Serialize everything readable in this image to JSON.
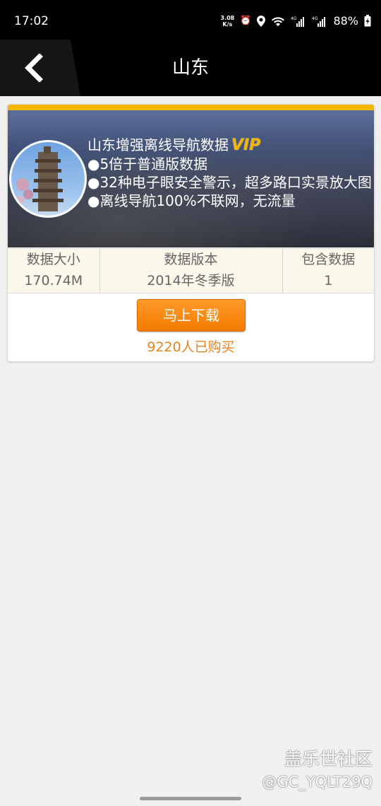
{
  "status_bar": {
    "time": "17:02",
    "net_speed_value": "3.08",
    "net_speed_unit": "K/s",
    "battery": "88%",
    "icons": [
      "alarm-icon",
      "location-icon",
      "wifi-icon",
      "signal-4g-icon",
      "signal-4g-icon",
      "battery-charging-icon"
    ]
  },
  "header": {
    "title": "山东",
    "back_icon": "chevron-left-icon"
  },
  "card": {
    "accent_color": "#f2b700",
    "product_title": "山东增强离线导航数据",
    "badge": "VIP",
    "features": [
      "●5倍于普通版数据",
      "●32种电子眼安全警示，超多路口实景放大图",
      "●离线导航100%不联网，无流量"
    ],
    "stats": [
      {
        "label": "数据大小",
        "value": "170.74M"
      },
      {
        "label": "数据版本",
        "value": "2014年冬季版"
      },
      {
        "label": "包含数据",
        "value": "1"
      }
    ],
    "download_button": "马上下载",
    "buyers": "9220人已购买"
  },
  "watermark": {
    "line1": "盖乐世社区",
    "line2": "@GC_YQLT29Q"
  }
}
